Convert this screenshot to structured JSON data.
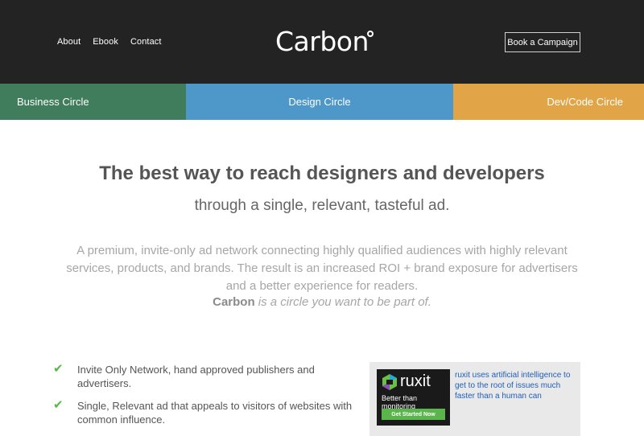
{
  "nav": {
    "items": [
      "About",
      "Ebook",
      "Contact"
    ],
    "logo": "Carbon",
    "cta": "Book a Campaign"
  },
  "circles": [
    "Business Circle",
    "Design Circle",
    "Dev/Code Circle"
  ],
  "colors": {
    "topbar": "#232323",
    "business": "#3f7d5c",
    "design": "#4d97c9",
    "dev": "#e1a447",
    "check": "#56b846",
    "ad_link": "#1f5fb9"
  },
  "hero": {
    "headline": "The best way to reach designers and developers",
    "subhead": "through a single, relevant, tasteful ad.",
    "blurb": "A premium, invite-only ad network connecting highly qualified audiences with highly relevant services, products, and brands. The result is an increased ROI + brand exposure for advertisers and a better experience for readers.",
    "tagline_brand": "Carbon",
    "tagline_rest": " is a circle you want to be part of."
  },
  "features": [
    {
      "icon": "check-icon",
      "text": "Invite Only Network, hand approved publishers and advertisers."
    },
    {
      "icon": "check-icon",
      "text": "Single, Relevant ad that appeals to visitors of websites with common influence."
    }
  ],
  "ad": {
    "brand": "ruxit",
    "tagline": "Better than monitoring",
    "button": "Get Started Now",
    "copy": "ruxit uses artificial intelligence to get to the root of issues much faster than a human can"
  }
}
